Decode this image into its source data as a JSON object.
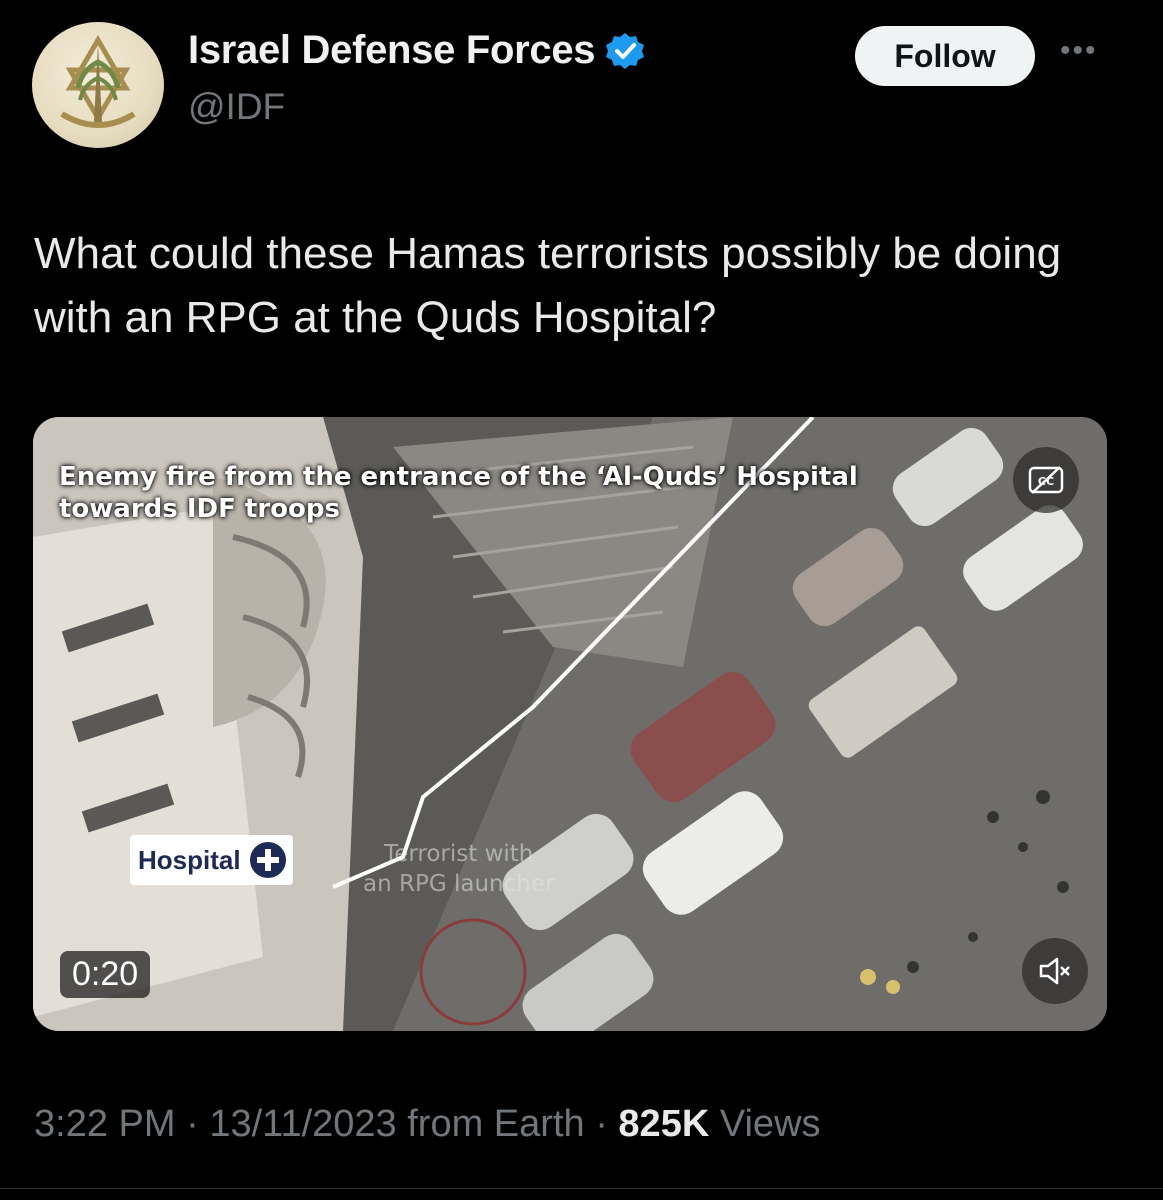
{
  "author": {
    "name": "Israel Defense Forces",
    "handle": "@IDF",
    "verified": true,
    "avatar_icon": "idf-emblem-icon"
  },
  "actions": {
    "follow_label": "Follow",
    "more_icon": "more-options-icon"
  },
  "tweet": {
    "text": "What could these Hamas terrorists possibly be doing with an RPG at the Quds Hospital?"
  },
  "media": {
    "caption_line1": "Enemy fire from the entrance of the ‘Al-Quds’ Hospital",
    "caption_line2": "towards IDF troops",
    "hospital_label": "Hospital",
    "rpg_label_line1": "Terrorist with",
    "rpg_label_line2": "an RPG launcher",
    "duration": "0:20",
    "cc_icon": "closed-captions-off-icon",
    "mute_icon": "muted-speaker-icon"
  },
  "meta": {
    "time": "3:22 PM",
    "separator": " · ",
    "date": "13/11/2023",
    "source": "from Earth",
    "views_count": "825K",
    "views_label": "Views"
  },
  "colors": {
    "background": "#000000",
    "text": "#e7e9ea",
    "muted": "#71767b",
    "verified_badge": "#1d9bf0",
    "follow_bg": "#eff3f4"
  }
}
